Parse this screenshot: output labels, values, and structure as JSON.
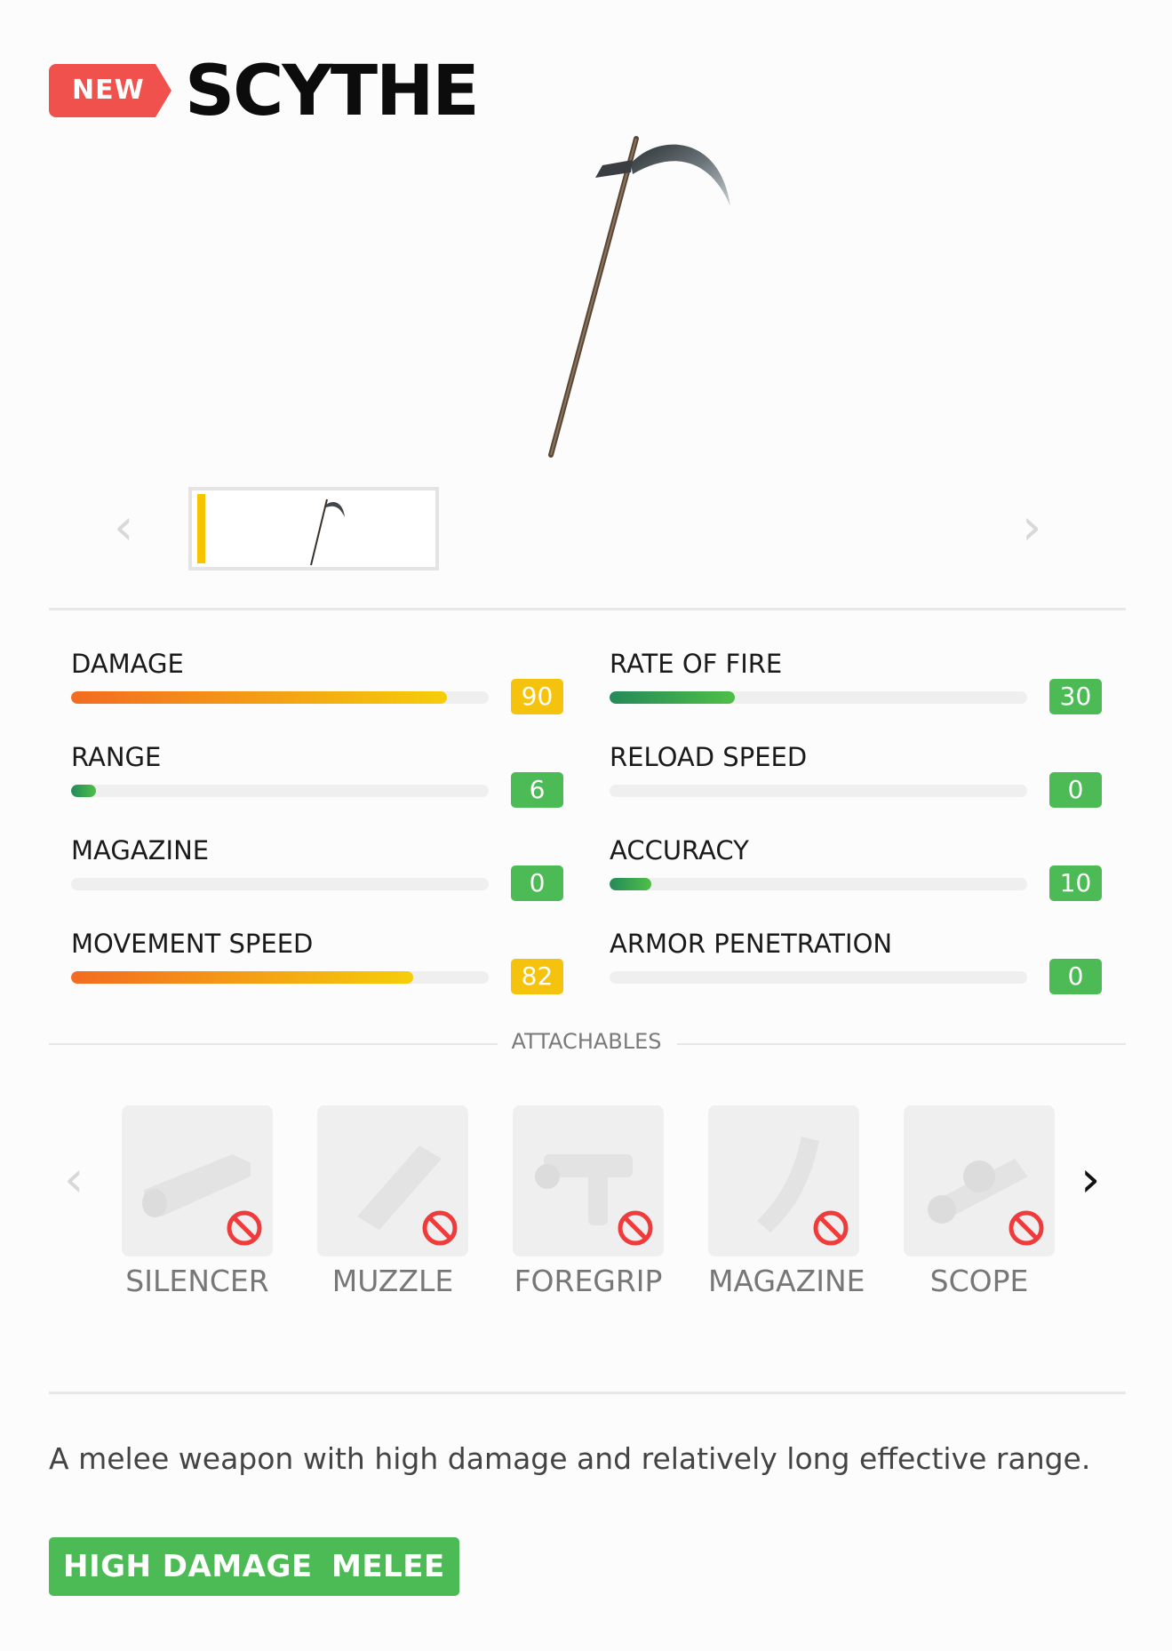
{
  "header": {
    "badge": "NEW",
    "title": "SCYTHE"
  },
  "gallery": {
    "prev_icon": "chevron-left-icon",
    "next_icon": "chevron-right-icon"
  },
  "stats": [
    {
      "label": "DAMAGE",
      "value": "90",
      "fraction": 0.9,
      "color": "orange"
    },
    {
      "label": "RATE OF FIRE",
      "value": "30",
      "fraction": 0.3,
      "color": "green"
    },
    {
      "label": "RANGE",
      "value": "6",
      "fraction": 0.06,
      "color": "green"
    },
    {
      "label": "RELOAD SPEED",
      "value": "0",
      "fraction": 0,
      "color": "green"
    },
    {
      "label": "MAGAZINE",
      "value": "0",
      "fraction": 0,
      "color": "green"
    },
    {
      "label": "ACCURACY",
      "value": "10",
      "fraction": 0.1,
      "color": "green"
    },
    {
      "label": "MOVEMENT SPEED",
      "value": "82",
      "fraction": 0.82,
      "color": "orange"
    },
    {
      "label": "ARMOR PENETRATION",
      "value": "0",
      "fraction": 0,
      "color": "green"
    }
  ],
  "attachables": {
    "title": "ATTACHABLES",
    "items": [
      "SILENCER",
      "MUZZLE",
      "FOREGRIP",
      "MAGAZINE",
      "SCOPE"
    ]
  },
  "description": "A melee weapon with high damage and relatively long effective range.",
  "tags": [
    "HIGH DAMAGE",
    "MELEE"
  ],
  "colors": {
    "badge": "#f0514d",
    "accent_yellow": "#f5c30d",
    "accent_green": "#4cbb55",
    "bar_orange_start": "#f36b21",
    "bar_green_start": "#248a5a"
  }
}
